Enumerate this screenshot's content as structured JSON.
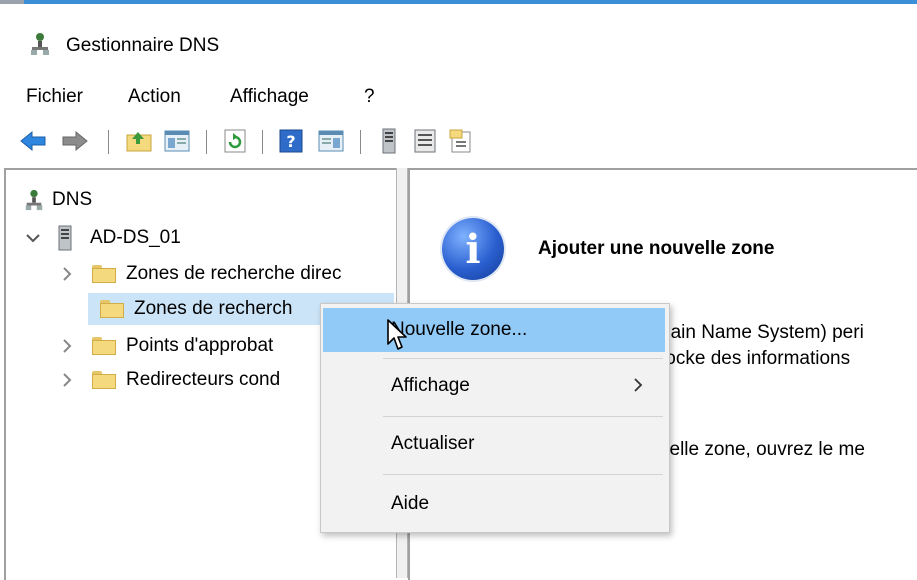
{
  "window": {
    "title": "Gestionnaire DNS",
    "accent": "#3a8fd8"
  },
  "menubar": {
    "items": [
      "Fichier",
      "Action",
      "Affichage",
      "?"
    ]
  },
  "toolbar": {
    "icons": [
      "back-arrow-icon",
      "forward-arrow-icon",
      "up-folder-icon",
      "show-hide-tree-icon",
      "refresh-icon",
      "help-icon",
      "action-pane-icon",
      "server-icon",
      "list-icon",
      "properties-icon"
    ]
  },
  "tree": {
    "root": "DNS",
    "server": "AD-DS_01",
    "children": [
      "Zones de recherche direc",
      "Zones de recherch",
      "Points d'approbat",
      "Redirecteurs cond"
    ]
  },
  "info": {
    "title": "Ajouter une nouvelle zone",
    "line1": "nain Name System) peri",
    "line2": "tocke des informations",
    "line3": "velle zone, ouvrez le me"
  },
  "context_menu": {
    "items": {
      "new_zone": "Nouvelle zone...",
      "view": "Affichage",
      "refresh": "Actualiser",
      "help": "Aide"
    },
    "highlight": "#91c9f7"
  }
}
